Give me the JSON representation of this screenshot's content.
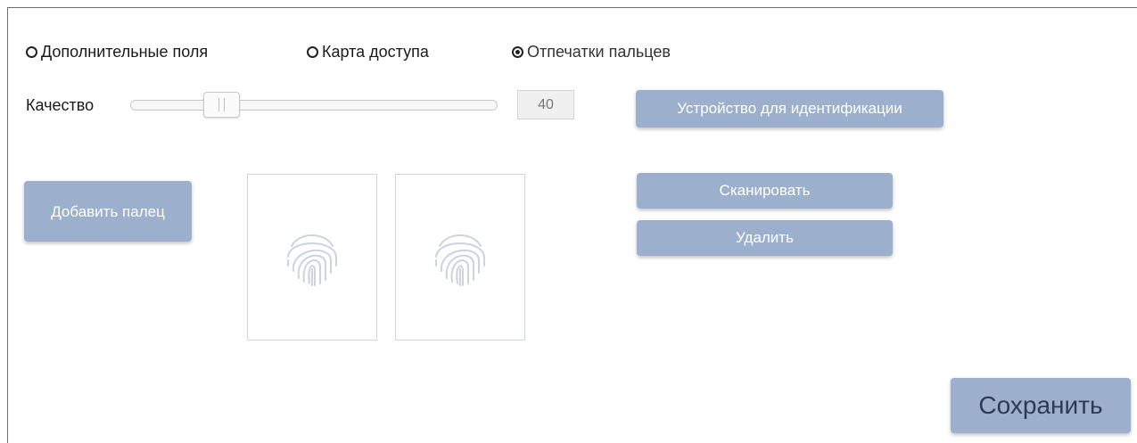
{
  "mode_options": [
    {
      "label": "Дополнительные поля",
      "checked": false
    },
    {
      "label": "Карта доступа",
      "checked": false
    },
    {
      "label": "Отпечатки пальцев",
      "checked": true
    }
  ],
  "quality": {
    "label": "Качество",
    "value": "40",
    "level": 0.22
  },
  "buttons": {
    "device": "Устройство для идентификации",
    "add_finger": "Добавить палец",
    "scan": "Сканировать",
    "delete": "Удалить",
    "save": "Сохранить"
  },
  "fingerprint_slots": [
    {
      "icon": "fingerprint-icon"
    },
    {
      "icon": "fingerprint-icon"
    }
  ],
  "colors": {
    "button_bg": "#9cb0cd",
    "button_text": "#ffffff",
    "fingerprint_icon": "#c9d3e2"
  }
}
